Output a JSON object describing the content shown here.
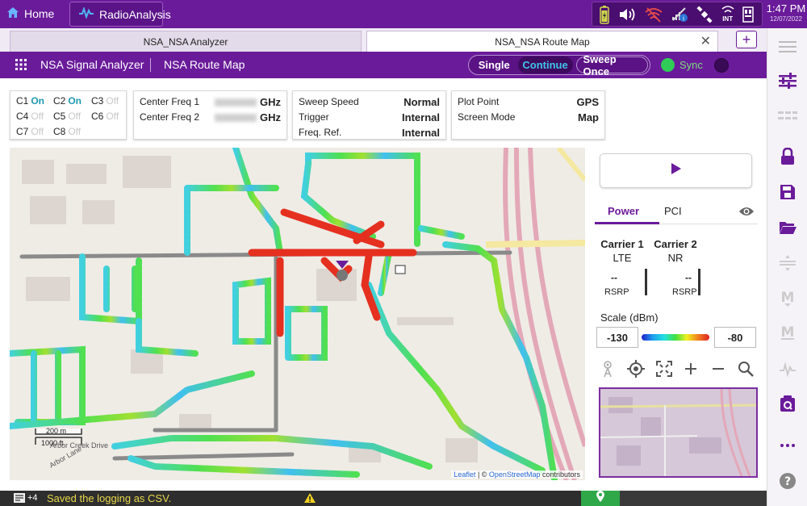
{
  "topbar": {
    "home_label": "Home",
    "app_label": "RadioAnalysis",
    "time": "1:47 PM",
    "date": "12/07/2022",
    "int_label": "INT"
  },
  "tabs": [
    {
      "label": "NSA_NSA Analyzer"
    },
    {
      "label": "NSA_NSA Route Map"
    }
  ],
  "toolbar": {
    "title1": "NSA Signal Analyzer",
    "title2": "NSA Route Map",
    "single": "Single",
    "continue": "Continue",
    "sweep_once": "Sweep Once",
    "sync": "Sync"
  },
  "carriers_panel": {
    "items": [
      {
        "label": "C1",
        "state": "On"
      },
      {
        "label": "C2",
        "state": "On"
      },
      {
        "label": "C3",
        "state": "Off"
      },
      {
        "label": "C4",
        "state": "Off"
      },
      {
        "label": "C5",
        "state": "Off"
      },
      {
        "label": "C6",
        "state": "Off"
      },
      {
        "label": "C7",
        "state": "Off"
      },
      {
        "label": "C8",
        "state": "Off"
      }
    ]
  },
  "freq_panel": {
    "cf1_label": "Center Freq 1",
    "cf1_unit": "GHz",
    "cf2_label": "Center Freq 2",
    "cf2_unit": "GHz"
  },
  "sweep_panel": {
    "speed_label": "Sweep Speed",
    "speed_value": "Normal",
    "trigger_label": "Trigger",
    "trigger_value": "Internal",
    "ref_label": "Freq. Ref.",
    "ref_value": "Internal"
  },
  "plot_panel": {
    "plot_label": "Plot Point",
    "plot_value": "GPS",
    "mode_label": "Screen Mode",
    "mode_value": "Map"
  },
  "map": {
    "scale_m": "200 m",
    "scale_ft": "1000 ft",
    "attr_leaflet": "Leaflet",
    "attr_sep": " | © ",
    "attr_osm": "OpenStreetMap",
    "attr_tail": " contributors",
    "street1": "Arbor Creek Drive",
    "street2": "Arbor Lane"
  },
  "right_panel": {
    "tab_power": "Power",
    "tab_pci": "PCI",
    "carrier1_name": "Carrier 1",
    "carrier1_tech": "LTE",
    "carrier2_name": "Carrier 2",
    "carrier2_tech": "NR",
    "dash": "--",
    "rsrp": "RSRP",
    "scale_label": "Scale (dBm)",
    "scale_min": "-130",
    "scale_max": "-80"
  },
  "bottombar": {
    "count": "+4",
    "message": "Saved the logging as CSV."
  }
}
